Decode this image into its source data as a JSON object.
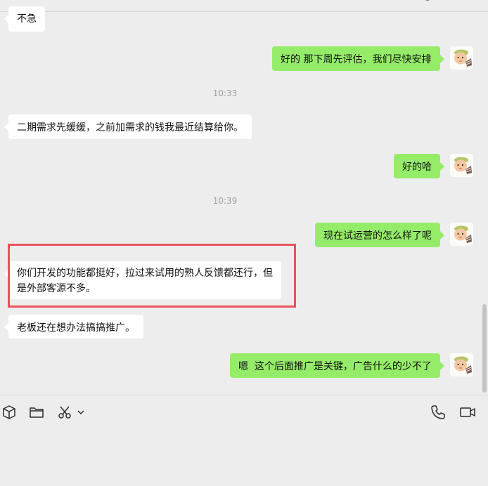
{
  "messages": [
    {
      "side": "left",
      "text": "不急"
    },
    {
      "side": "right",
      "text": "好的 那下周先评估，我们尽快安排"
    },
    {
      "type": "time",
      "text": "10:33"
    },
    {
      "side": "left",
      "text": "二期需求先缓缓，之前加需求的钱我最近结算给你。"
    },
    {
      "side": "right",
      "text": "好的哈"
    },
    {
      "type": "time",
      "text": "10:39"
    },
    {
      "side": "right",
      "text": "现在试运营的怎么样了呢"
    },
    {
      "side": "left",
      "text": "你们开发的功能都挺好，拉过来试用的熟人反馈都还行，但是外部客源不多。",
      "highlighted": true
    },
    {
      "side": "left",
      "text": "老板还在想办法搞搞推广。"
    },
    {
      "side": "right",
      "text": "嗯  这个后面推广是关键，广告什么的少不了"
    }
  ],
  "toolbar": {
    "left_icons": [
      "box-icon",
      "folder-icon",
      "scissors-icon",
      "chevron-down-icon"
    ],
    "right_icons": [
      "phone-icon",
      "video-icon"
    ]
  },
  "colors": {
    "background": "#ededed",
    "self_bubble": "#95ec69",
    "other_bubble": "#ffffff",
    "highlight_border": "#e9535a"
  }
}
